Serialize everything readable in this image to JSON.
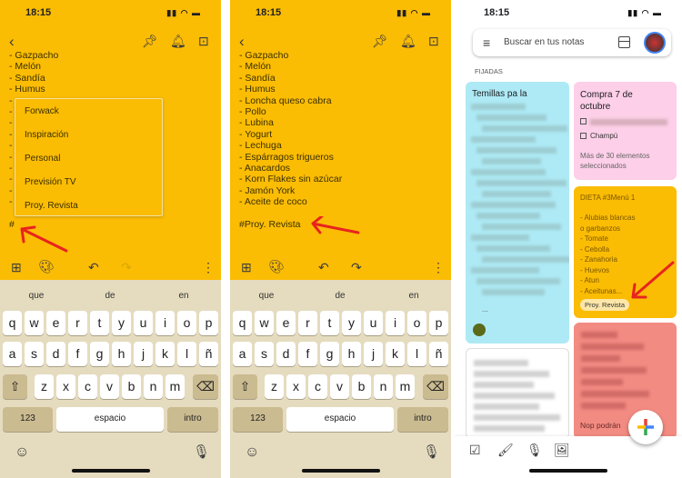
{
  "status": {
    "time": "18:15"
  },
  "panel1": {
    "note_lines": [
      "- Gazpacho",
      "- Melón",
      "- Sandía",
      "- Humus"
    ],
    "label_suggestions": [
      "Forwack",
      "Inspiración",
      "Personal",
      "Previsión TV",
      "Proy. Revista"
    ],
    "typed_text": "#"
  },
  "panel2": {
    "note_lines": [
      "- Gazpacho",
      "- Melón",
      "- Sandía",
      "- Humus",
      "- Loncha queso cabra",
      "- Pollo",
      "- Lubina",
      "- Yogurt",
      "- Lechuga",
      "- Espárragos trigueros",
      "- Anacardos",
      "- Korn Flakes sin azúcar",
      "- Jamón York",
      "- Aceite de coco"
    ],
    "typed_text": "#Proy. Revista"
  },
  "keyboard": {
    "suggestions": [
      "que",
      "de",
      "en"
    ],
    "row1": [
      "q",
      "w",
      "e",
      "r",
      "t",
      "y",
      "u",
      "i",
      "o",
      "p"
    ],
    "row2": [
      "a",
      "s",
      "d",
      "f",
      "g",
      "h",
      "j",
      "k",
      "l",
      "ñ"
    ],
    "row3": [
      "z",
      "x",
      "c",
      "v",
      "b",
      "n",
      "m"
    ],
    "numbers_label": "123",
    "space_label": "espacio",
    "return_label": "intro"
  },
  "panel3": {
    "search_placeholder": "Buscar en tus notas",
    "section_label": "FIJADAS",
    "card_cyan": {
      "title": "Temillas pa la",
      "more": "..."
    },
    "card_pink": {
      "title": "Compra 7 de octubre",
      "item": "Champú",
      "footer": "Más de 30 elementos seleccionados"
    },
    "card_yellow": {
      "title": "DIETA #3Menú 1",
      "lines": [
        "- Alubias blancas",
        "o garbanzos",
        "- Tomate",
        "- Cebolla",
        "- Zanahoria",
        "- Huevos",
        "- Atun",
        "- Aceitunas..."
      ],
      "label_chip": "Proy. Revista"
    },
    "card_red": {
      "footer": "Nop podrán"
    }
  },
  "colors": {
    "note_yellow": "#fbbc04",
    "keyboard": "#e5dbbe",
    "cyan": "#aeeaf5",
    "pink": "#fdcfe8",
    "red": "#f28b82",
    "arrow": "#e8231f"
  }
}
